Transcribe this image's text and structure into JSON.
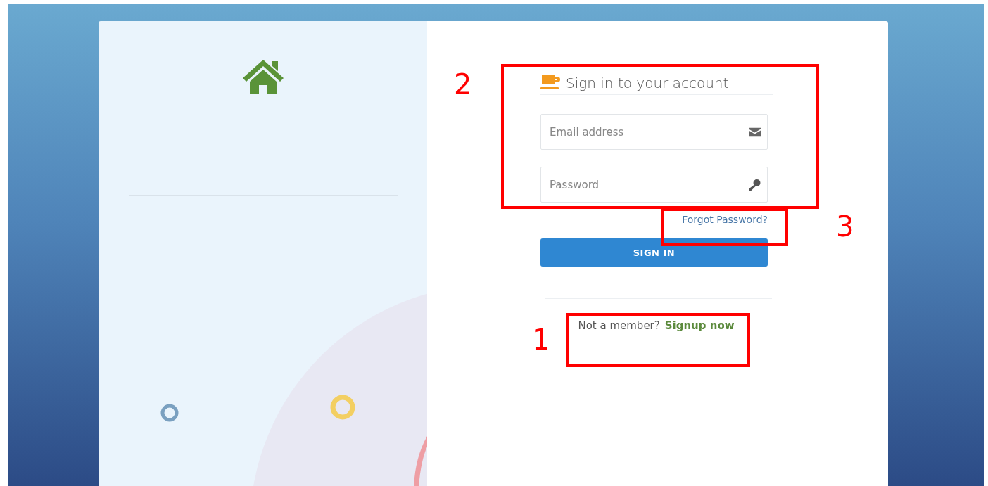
{
  "form": {
    "title": "Sign in to your account",
    "fields": [
      {
        "kind": "email",
        "placeholder": "Email address"
      },
      {
        "kind": "password",
        "placeholder": "Password"
      }
    ],
    "forgot_link": "Forgot Password?",
    "submit_button": "SIGN IN",
    "signup_prompt": "Not a member?",
    "signup_link": "Signup now"
  },
  "annotations": [
    {
      "label": "2"
    },
    {
      "label": "3"
    },
    {
      "label": "1"
    }
  ]
}
